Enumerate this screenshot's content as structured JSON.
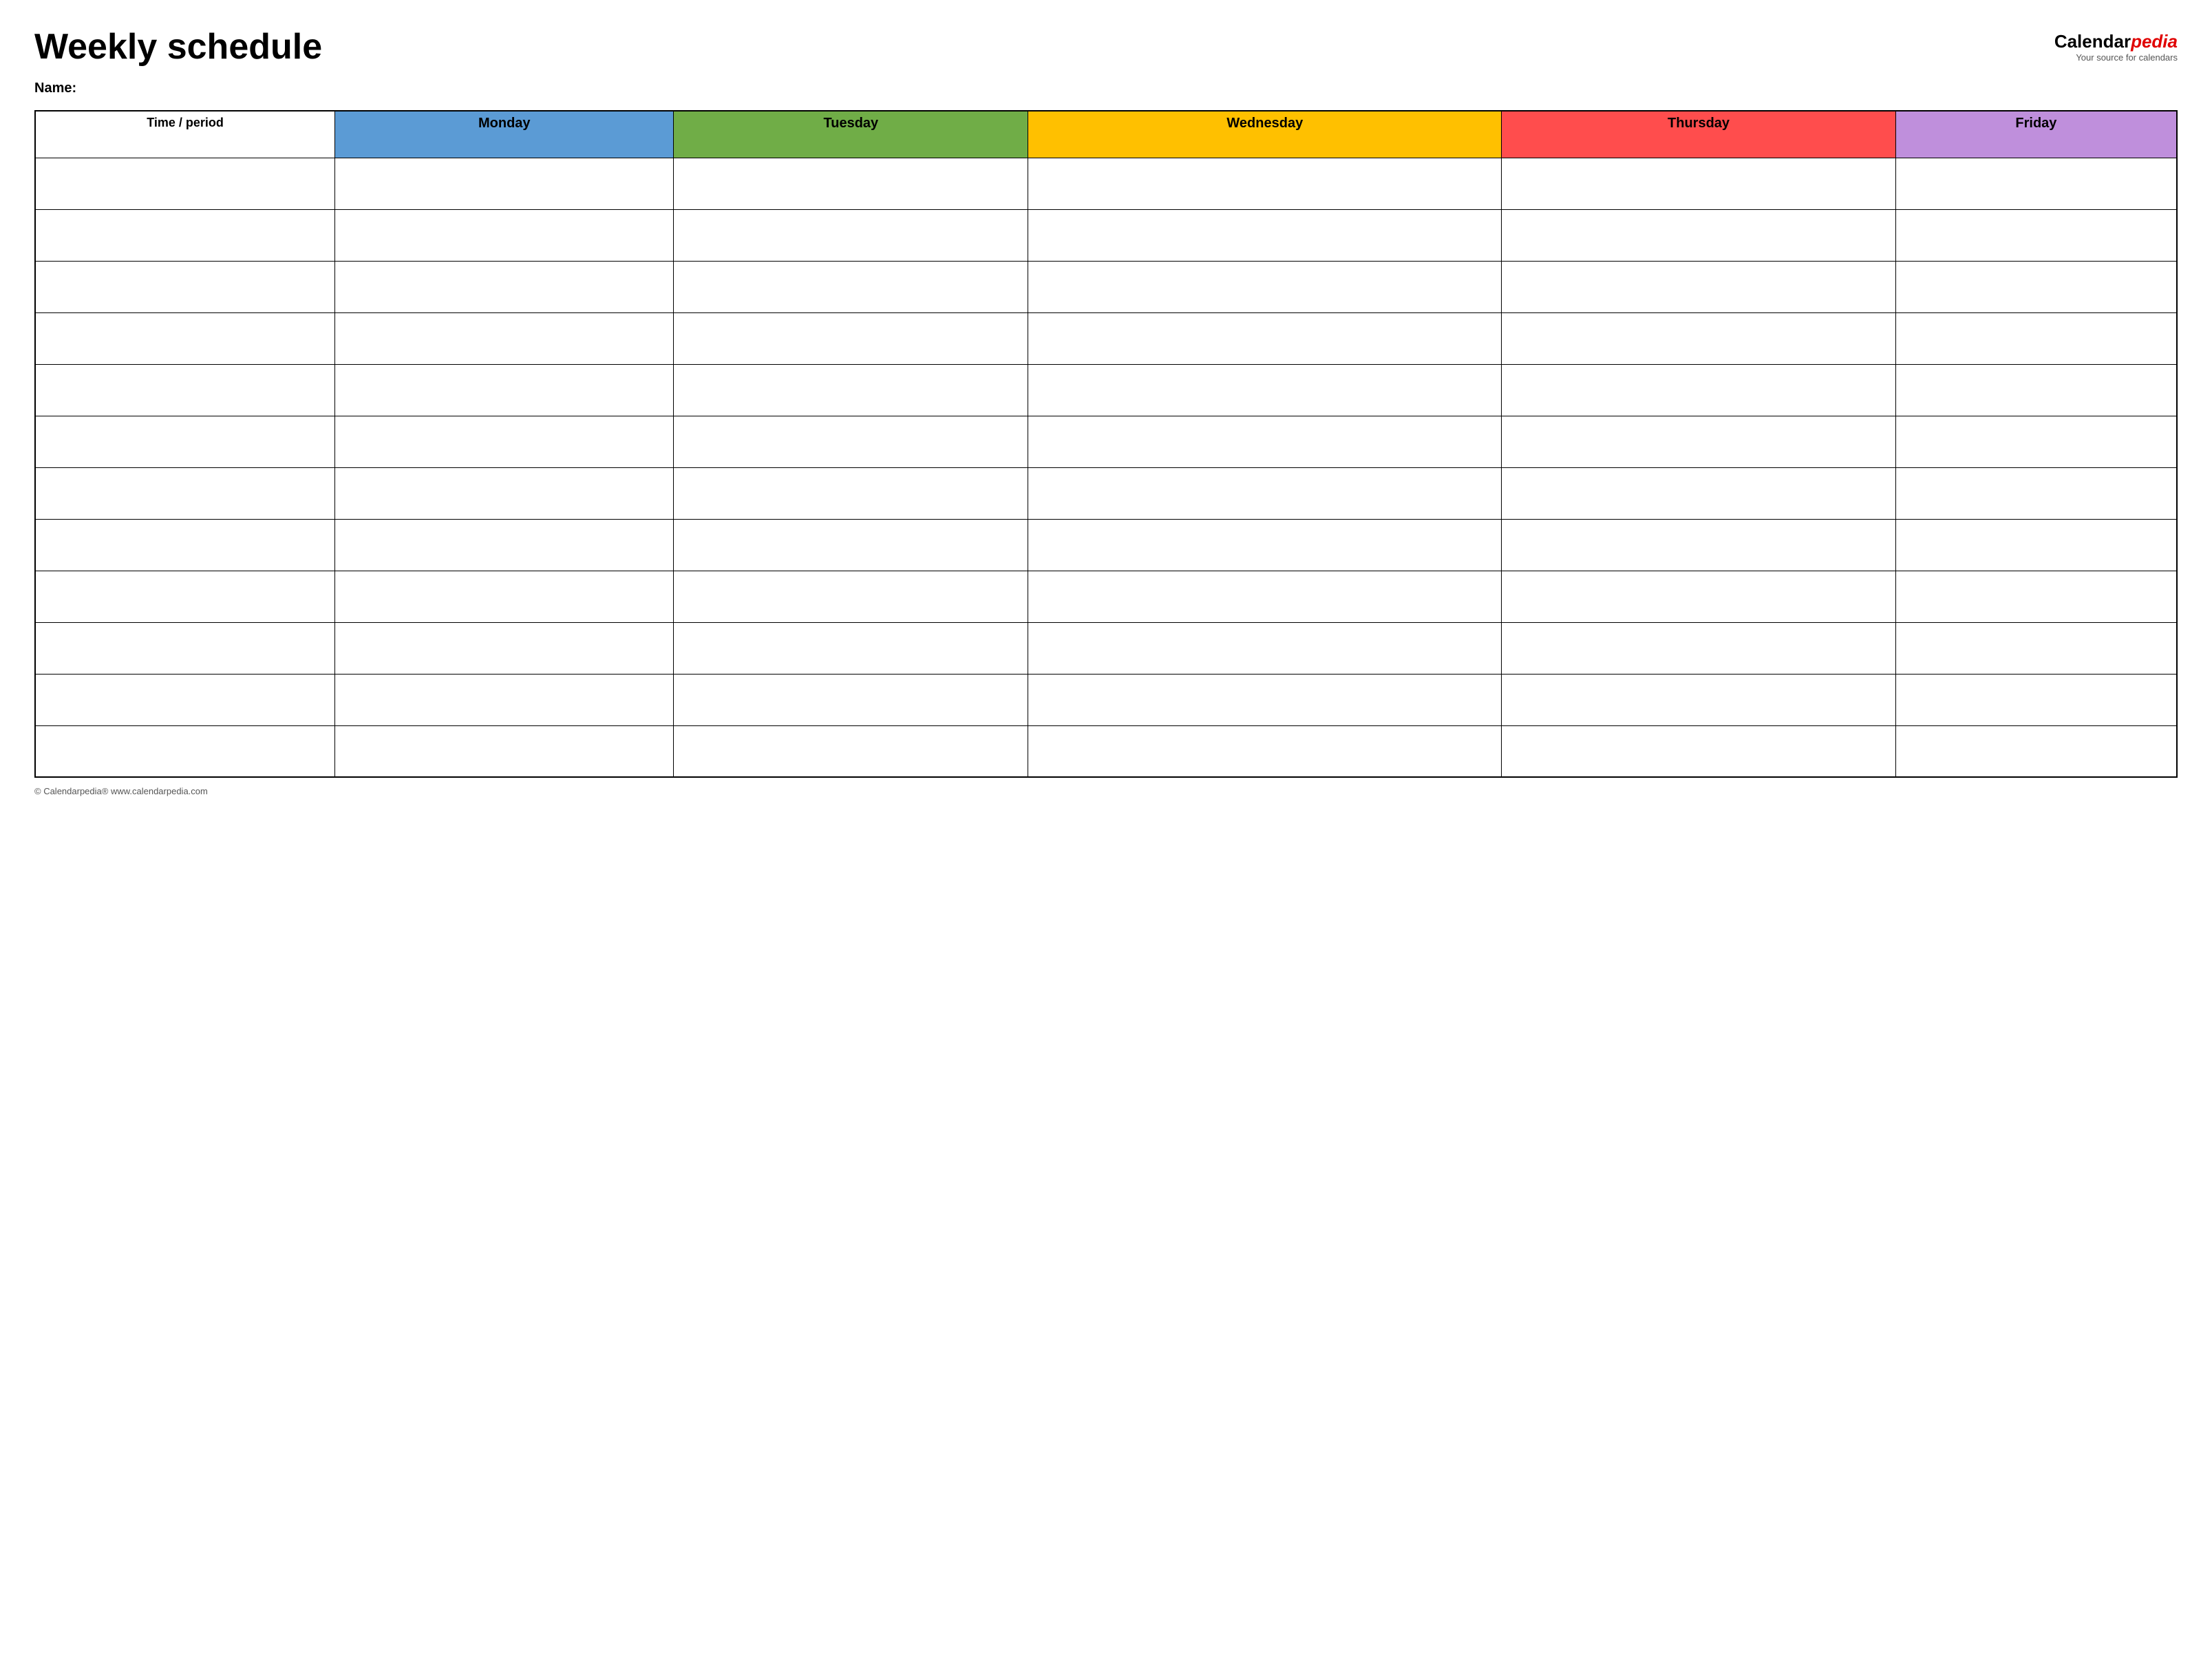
{
  "header": {
    "title": "Weekly schedule",
    "logo": {
      "calendar": "Calendar",
      "pedia": "pedia",
      "tagline": "Your source for calendars"
    }
  },
  "name_label": "Name:",
  "table": {
    "headers": {
      "time": "Time / period",
      "monday": "Monday",
      "tuesday": "Tuesday",
      "wednesday": "Wednesday",
      "thursday": "Thursday",
      "friday": "Friday"
    },
    "row_count": 12
  },
  "footer": {
    "text": "© Calendarpedia®  www.calendarpedia.com"
  }
}
